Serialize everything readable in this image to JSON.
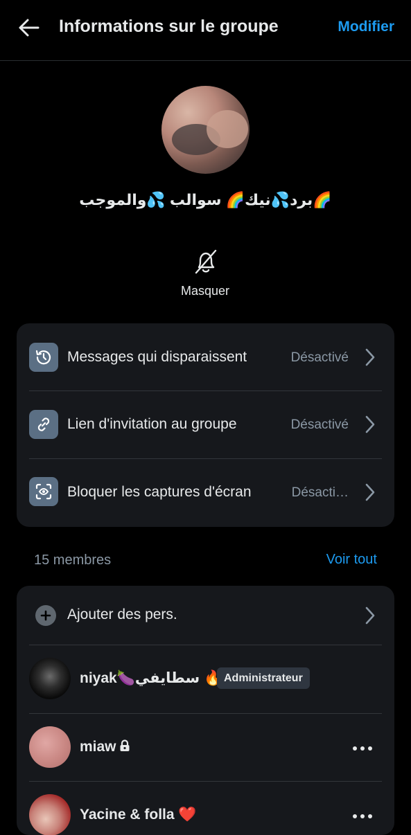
{
  "header": {
    "title": "Informations sur le groupe",
    "edit_label": "Modifier"
  },
  "group": {
    "name": "برد💦نيك🌈 سوالب 💦والموجب🌈"
  },
  "mute": {
    "label": "Masquer"
  },
  "settings": [
    {
      "label": "Messages qui disparaissent",
      "value": "Désactivé",
      "icon": "timer-icon"
    },
    {
      "label": "Lien d'invitation au groupe",
      "value": "Désactivé",
      "icon": "link-icon"
    },
    {
      "label": "Bloquer les captures d'écran",
      "value": "Désacti…",
      "icon": "screenshot-block-icon"
    }
  ],
  "members_section": {
    "count_label": "15 membres",
    "see_all_label": "Voir tout",
    "add_label": "Ajouter des pers."
  },
  "members": [
    {
      "name": "niyak🍆سطايفي 🔥",
      "badge": "Administrateur"
    },
    {
      "name": "miaw",
      "locked": true
    },
    {
      "name": "Yacine & folla ❤️"
    }
  ],
  "colors": {
    "background": "#000000",
    "card": "#16181c",
    "accent": "#1d9bf0",
    "secondary_text": "#8b98a5",
    "icon_tile": "#5b6f84"
  }
}
